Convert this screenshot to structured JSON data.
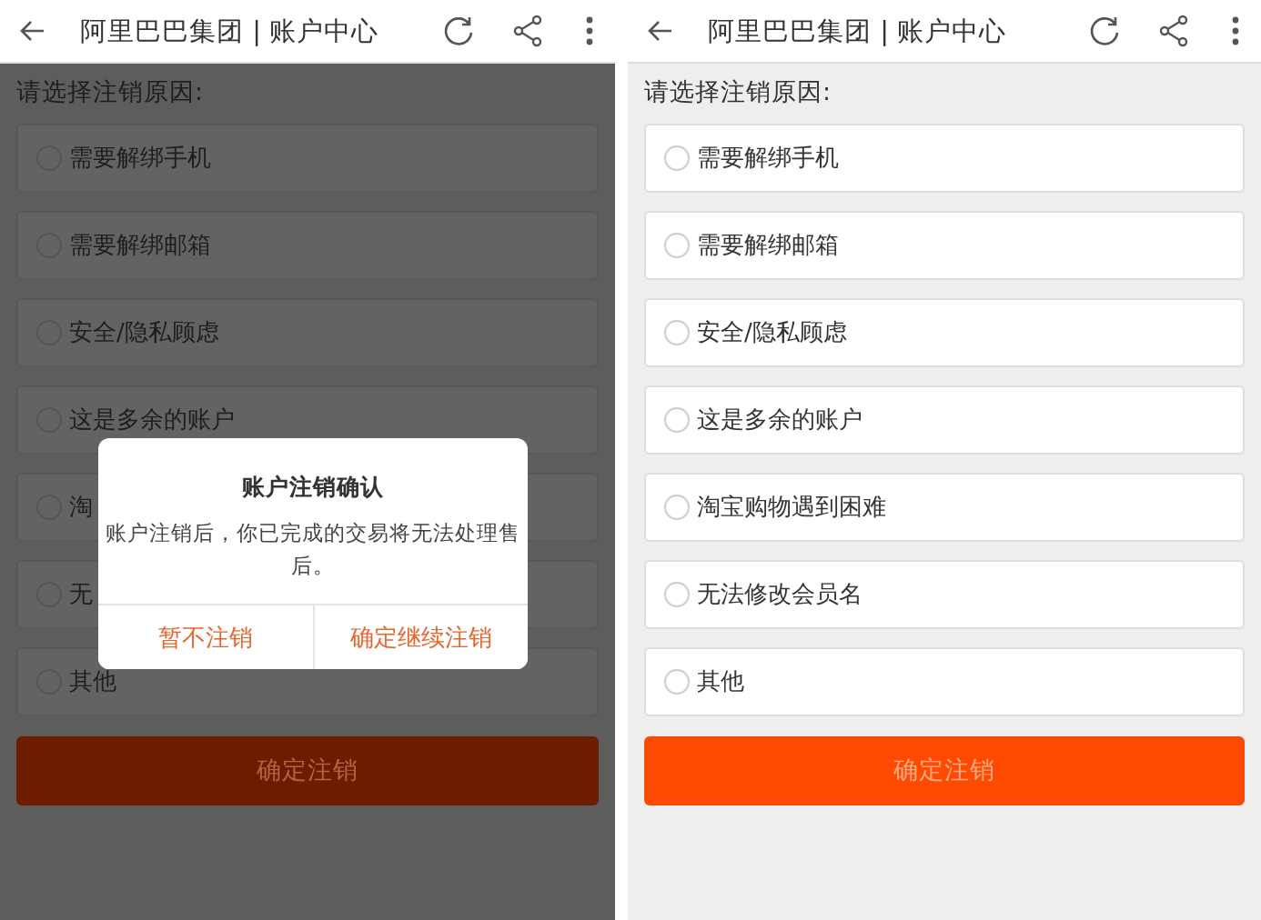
{
  "screens": [
    {
      "dimmed": true,
      "title": "阿里巴巴集团 | 账户中心",
      "prompt": "请选择注销原因:",
      "reasons": [
        {
          "label": "需要解绑手机",
          "selected": false
        },
        {
          "label": "需要解绑邮箱",
          "selected": false
        },
        {
          "label": "安全/隐私顾虑",
          "selected": false
        },
        {
          "label": "这是多余的账户",
          "selected": false
        },
        {
          "label": "淘",
          "selected": false
        },
        {
          "label": "无",
          "selected": false
        },
        {
          "label": "其他",
          "selected": false
        }
      ],
      "submit": "确定注销",
      "dialog": {
        "title": "账户注销确认",
        "message": "账户注销后，你已完成的交易将无法处理售后。",
        "buttons": [
          "暂不注销",
          "确定继续注销"
        ]
      }
    },
    {
      "dimmed": false,
      "title": "阿里巴巴集团 | 账户中心",
      "prompt": "请选择注销原因:",
      "reasons": [
        {
          "label": "需要解绑手机",
          "selected": false
        },
        {
          "label": "需要解绑邮箱",
          "selected": false
        },
        {
          "label": "安全/隐私顾虑",
          "selected": false
        },
        {
          "label": "这是多余的账户",
          "selected": false
        },
        {
          "label": "淘宝购物遇到困难",
          "selected": false
        },
        {
          "label": "无法修改会员名",
          "selected": false
        },
        {
          "label": "其他",
          "selected": false
        }
      ],
      "submit": "确定注销"
    }
  ]
}
